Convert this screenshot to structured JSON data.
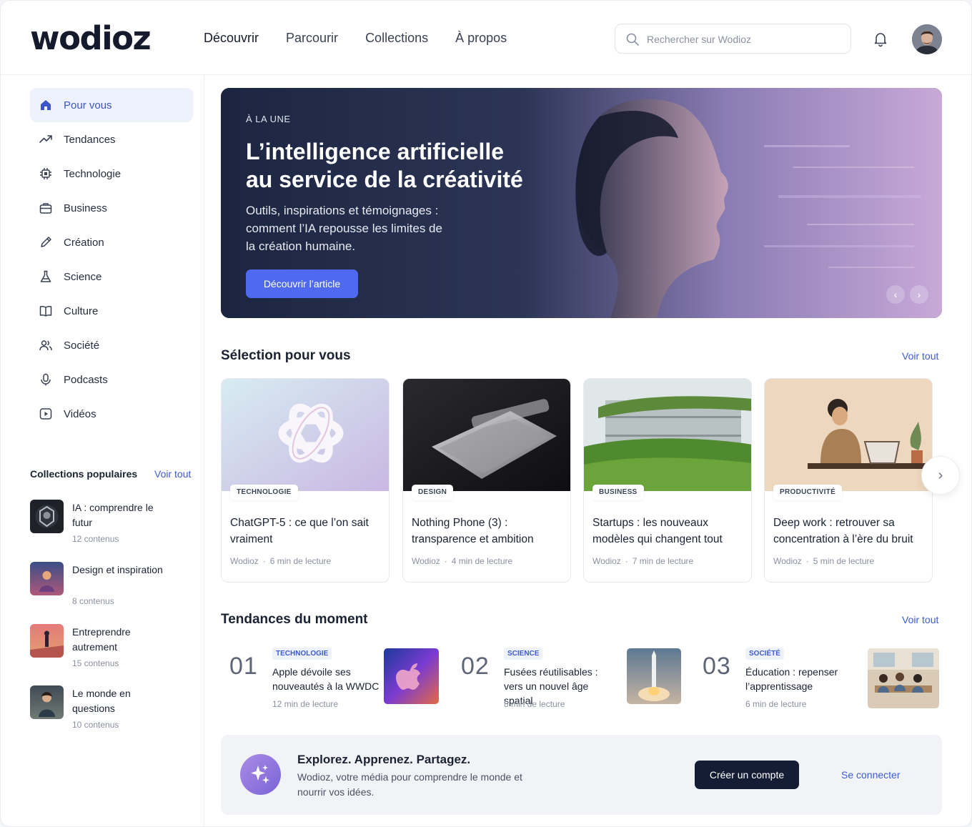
{
  "brand": {
    "logo": "wodioz"
  },
  "nav": [
    "Découvrir",
    "Parcourir",
    "Collections",
    "À propos"
  ],
  "search": {
    "placeholder": "Rechercher sur Wodioz",
    "value": ""
  },
  "sidebar": {
    "items": [
      {
        "label": "Pour vous",
        "icon": "home-icon",
        "active": true
      },
      {
        "label": "Tendances",
        "icon": "trending-icon"
      },
      {
        "label": "Technologie",
        "icon": "chip-icon"
      },
      {
        "label": "Business",
        "icon": "briefcase-icon"
      },
      {
        "label": "Création",
        "icon": "pen-icon"
      },
      {
        "label": "Science",
        "icon": "flask-icon"
      },
      {
        "label": "Culture",
        "icon": "book-icon"
      },
      {
        "label": "Société",
        "icon": "users-icon"
      },
      {
        "label": "Podcasts",
        "icon": "microphone-icon"
      },
      {
        "label": "Vidéos",
        "icon": "play-icon"
      }
    ],
    "collections_title": "Collections populaires",
    "collections_all": "Voir tout",
    "collections": [
      {
        "name": "IA : comprendre le futur",
        "count": "12 contenus"
      },
      {
        "name": "Design et inspiration",
        "count": "8 contenus"
      },
      {
        "name": "Entreprendre autrement",
        "count": "15 contenus"
      },
      {
        "name": "Le monde en questions",
        "count": "10 contenus"
      }
    ]
  },
  "hero": {
    "eyebrow": "À LA UNE",
    "title_line1": "L’intelligence artificielle",
    "title_line2": "au service de la créativité",
    "description": "Outils, inspirations et témoignages : comment l’IA repousse les limites de la création humaine.",
    "cta": "Découvrir l’article",
    "prev": "‹",
    "next": "›"
  },
  "selection": {
    "title": "Sélection pour vous",
    "all": "Voir tout",
    "cards": [
      {
        "tag": "TECHNOLOGIE",
        "title": "ChatGPT-5 : ce que l’on sait vraiment",
        "source": "Wodioz",
        "time": "6 min de lecture"
      },
      {
        "tag": "DESIGN",
        "title": "Nothing Phone (3) : transparence et ambition",
        "source": "Wodioz",
        "time": "4 min de lecture"
      },
      {
        "tag": "BUSINESS",
        "title": "Startups : les nouveaux modèles qui changent tout",
        "source": "Wodioz",
        "time": "7 min de lecture"
      },
      {
        "tag": "PRODUCTIVITÉ",
        "title": "Deep work : retrouver sa concentration à l’ère du bruit",
        "source": "Wodioz",
        "time": "5 min de lecture"
      }
    ],
    "next": "›"
  },
  "trending": {
    "title": "Tendances du moment",
    "all": "Voir tout",
    "items": [
      {
        "num": "01",
        "tag": "TECHNOLOGIE",
        "title": "Apple dévoile ses nouveautés à la WWDC",
        "time": "12 min de lecture"
      },
      {
        "num": "02",
        "tag": "SCIENCE",
        "title": "Fusées réutilisables : vers un nouvel âge spatial",
        "time": "8 min de lecture"
      },
      {
        "num": "03",
        "tag": "SOCIÉTÉ",
        "title": "Éducation : repenser l’apprentissage",
        "time": "6 min de lecture"
      }
    ]
  },
  "banner": {
    "title": "Explorez. Apprenez. Partagez.",
    "description": "Wodioz, votre média pour comprendre le monde et nourrir vos idées.",
    "primary": "Créer un compte",
    "secondary": "Se connecter"
  },
  "colors": {
    "accent": "#4f6af0",
    "link": "#3e5bd6",
    "dark": "#141d34",
    "active_bg": "#eef2fc"
  }
}
